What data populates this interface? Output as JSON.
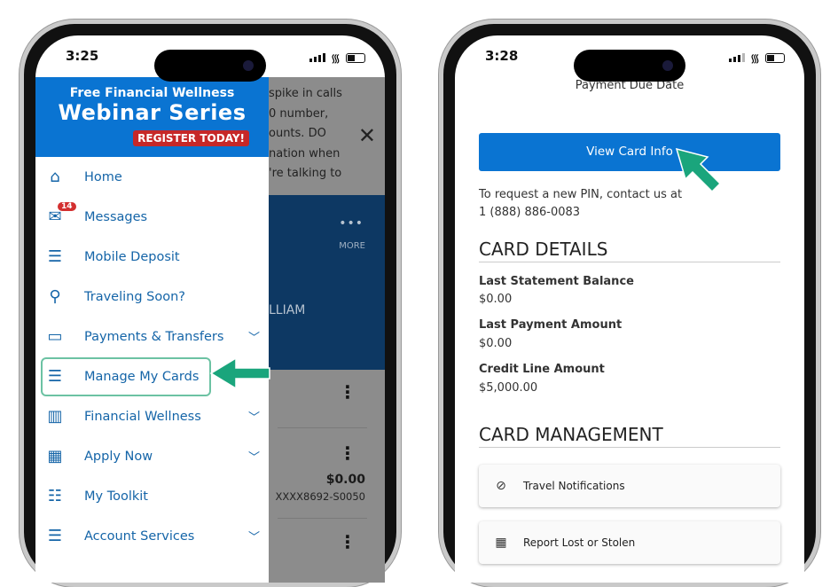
{
  "left_phone": {
    "time": "3:25",
    "banner": {
      "line1": "Free Financial Wellness",
      "line2": "Webinar Series",
      "cta": "REGISTER TODAY!"
    },
    "menu": [
      {
        "label": "Home",
        "icon": "home-icon",
        "expandable": false
      },
      {
        "label": "Messages",
        "icon": "mail-icon",
        "expandable": false,
        "badge": "14"
      },
      {
        "label": "Mobile Deposit",
        "icon": "menu-icon",
        "expandable": false
      },
      {
        "label": "Traveling Soon?",
        "icon": "location-pin-icon",
        "expandable": false
      },
      {
        "label": "Payments & Transfers",
        "icon": "credit-card-icon",
        "expandable": true
      },
      {
        "label": "Manage My Cards",
        "icon": "menu-icon",
        "expandable": false,
        "highlighted": true
      },
      {
        "label": "Financial Wellness",
        "icon": "bar-chart-icon",
        "expandable": true
      },
      {
        "label": "Apply Now",
        "icon": "calculator-icon",
        "expandable": true
      },
      {
        "label": "My Toolkit",
        "icon": "checklist-icon",
        "expandable": false
      },
      {
        "label": "Account Services",
        "icon": "menu-icon",
        "expandable": true
      }
    ],
    "background": {
      "alert_text": "spike in calls\n0 number,\nounts. DO\nnation when\n're talking to",
      "more_label": "MORE",
      "name_fragment": "LLIAM",
      "balance": "$0.00",
      "account": "XXXX8692-S0050"
    }
  },
  "right_phone": {
    "time": "3:28",
    "payment_due_label": "Payment Due Date",
    "view_card_button": "View Card Info",
    "pin_text": "To request a new PIN, contact us at",
    "phone_number": "1 (888) 886-0083",
    "card_details_heading": "CARD DETAILS",
    "details": [
      {
        "label": "Last Statement Balance",
        "value": "$0.00"
      },
      {
        "label": "Last Payment Amount",
        "value": "$0.00"
      },
      {
        "label": "Credit Line Amount",
        "value": "$5,000.00"
      }
    ],
    "card_management_heading": "CARD MANAGEMENT",
    "actions": [
      {
        "label": "Travel Notifications",
        "icon": "compass-icon"
      },
      {
        "label": "Report Lost or Stolen",
        "icon": "card-alert-icon"
      }
    ]
  },
  "colors": {
    "brand_blue": "#0a74d2",
    "highlight_green": "#1aa57c",
    "badge_red": "#d32f2f",
    "menu_text": "#1565a8"
  }
}
